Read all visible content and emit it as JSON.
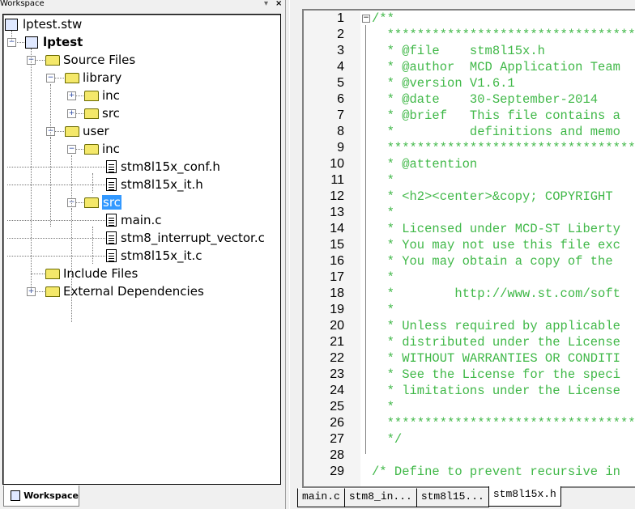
{
  "workspace": {
    "title": "Workspace",
    "pin": "▾",
    "close": "×",
    "tab_label": "Workspace"
  },
  "tree": [
    {
      "label": "lptest.stw",
      "level": 0,
      "type": "workspace"
    },
    {
      "label": "lptest",
      "level": 1,
      "type": "project",
      "bold": true,
      "expander": "−"
    },
    {
      "label": "Source Files",
      "level": 2,
      "type": "folder",
      "expander": "−"
    },
    {
      "label": "library",
      "level": 3,
      "type": "folder",
      "expander": "−"
    },
    {
      "label": "inc",
      "level": 4,
      "type": "folder",
      "expander": "+"
    },
    {
      "label": "src",
      "level": 4,
      "type": "folder",
      "expander": "+"
    },
    {
      "label": "user",
      "level": 3,
      "type": "folder",
      "expander": "−"
    },
    {
      "label": "inc",
      "level": 4,
      "type": "folder",
      "expander": "−"
    },
    {
      "label": "stm8l15x_conf.h",
      "level": 5,
      "type": "file"
    },
    {
      "label": "stm8l15x_it.h",
      "level": 5,
      "type": "file"
    },
    {
      "label": "src",
      "level": 4,
      "type": "folder",
      "expander": "−",
      "selected": true
    },
    {
      "label": "main.c",
      "level": 5,
      "type": "file"
    },
    {
      "label": "stm8_interrupt_vector.c",
      "level": 5,
      "type": "file"
    },
    {
      "label": "stm8l15x_it.c",
      "level": 5,
      "type": "file"
    },
    {
      "label": "Include Files",
      "level": 2,
      "type": "folder"
    },
    {
      "label": "External Dependencies",
      "level": 2,
      "type": "folder",
      "expander": "+"
    }
  ],
  "editor": {
    "lines": [
      "/**",
      "  ******************************************",
      "  * @file    stm8l15x.h",
      "  * @author  MCD Application Team",
      "  * @version V1.6.1",
      "  * @date    30-September-2014",
      "  * @brief   This file contains a",
      "  *          definitions and memo",
      "  ******************************************",
      "  * @attention",
      "  *",
      "  * <h2><center>&copy; COPYRIGHT",
      "  *",
      "  * Licensed under MCD-ST Liberty",
      "  * You may not use this file exc",
      "  * You may obtain a copy of the",
      "  *",
      "  *        http://www.st.com/soft",
      "  *",
      "  * Unless required by applicable",
      "  * distributed under the License",
      "  * WITHOUT WARRANTIES OR CONDITI",
      "  * See the License for the speci",
      "  * limitations under the License",
      "  *",
      "  ******************************************",
      "  */",
      "",
      "/* Define to prevent recursive in"
    ]
  },
  "tabs": [
    {
      "label": "main.c"
    },
    {
      "label": "stm8_in..."
    },
    {
      "label": "stm8l15..."
    },
    {
      "label": "stm8l15x.h",
      "active": true
    }
  ]
}
